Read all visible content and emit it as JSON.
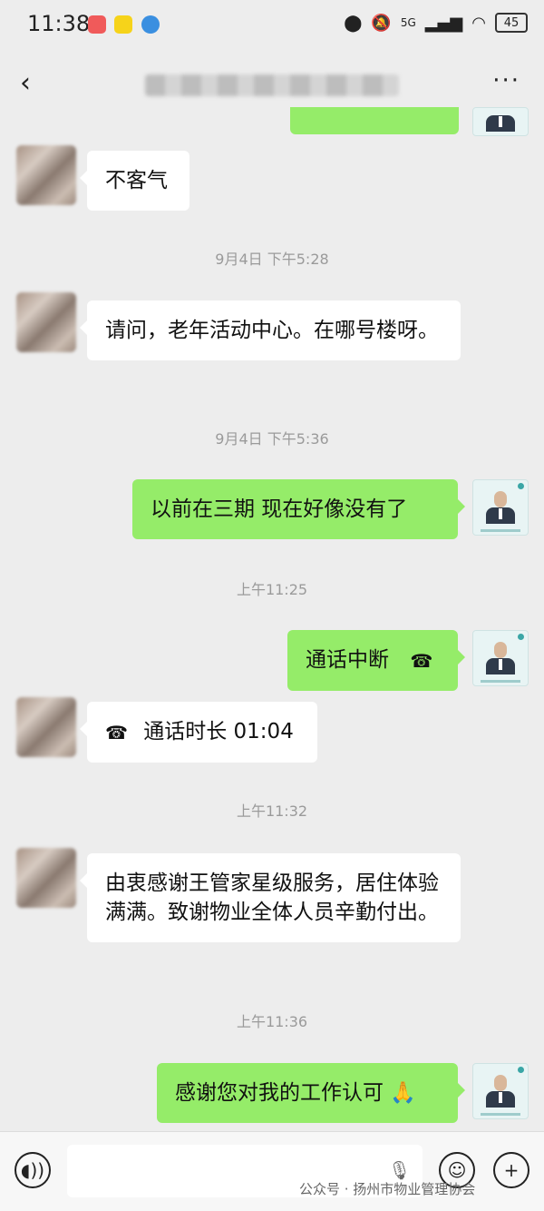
{
  "status_bar": {
    "time": "11:38",
    "network": "5G",
    "battery": "45"
  },
  "nav": {
    "title": "",
    "more": "···"
  },
  "messages": [
    {
      "id": "m1",
      "text": "不客气"
    },
    {
      "id": "ts1",
      "text": "9月4日 下午5:28"
    },
    {
      "id": "m2",
      "text": "请问，老年活动中心。在哪号楼呀。"
    },
    {
      "id": "ts2",
      "text": "9月4日 下午5:36"
    },
    {
      "id": "m3",
      "text": "以前在三期 现在好像没有了"
    },
    {
      "id": "ts3",
      "text": "上午11:25"
    },
    {
      "id": "m4",
      "text": "通话中断"
    },
    {
      "id": "m5",
      "text": "通话时长 01:04"
    },
    {
      "id": "ts4",
      "text": "上午11:32"
    },
    {
      "id": "m6",
      "text": "由衷感谢王管家星级服务，居住体验满满。致谢物业全体人员辛勤付出。"
    },
    {
      "id": "ts5",
      "text": "上午11:36"
    },
    {
      "id": "m7",
      "text": "感谢您对我的工作认可"
    }
  ],
  "input_bar": {
    "placeholder": ""
  },
  "watermark": "公众号 · 扬州市物业管理协会",
  "colors": {
    "outgoing": "#95ec69",
    "incoming": "#ffffff",
    "background": "#ededed"
  }
}
